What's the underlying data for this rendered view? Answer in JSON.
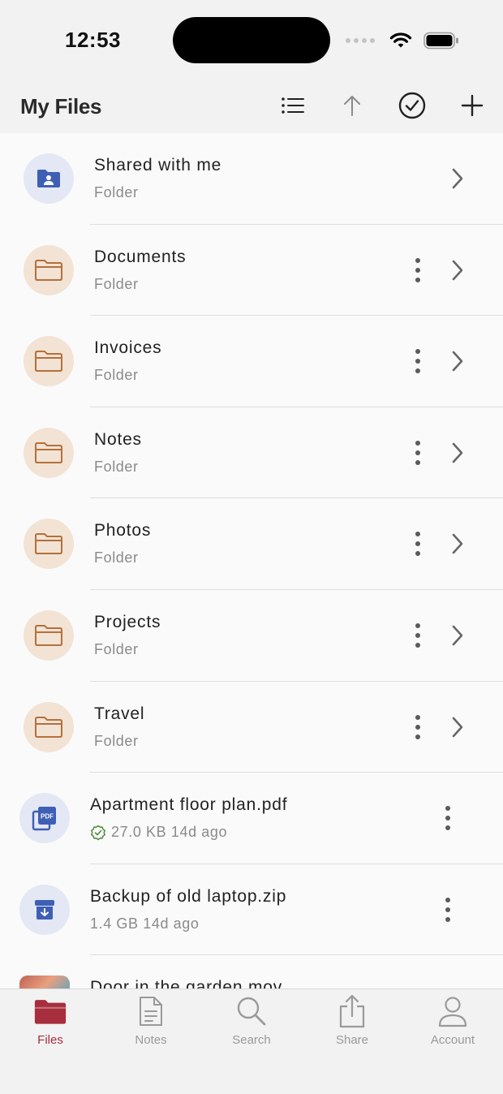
{
  "status_bar": {
    "time": "12:53"
  },
  "header": {
    "title": "My Files"
  },
  "colors": {
    "accent": "#a72e3c",
    "folder": "#b5703a",
    "blue": "#3f5fb5",
    "verified": "#4e8a3a"
  },
  "rows": [
    {
      "title": "Shared with me",
      "subtitle": "Folder",
      "icon": "shared-folder-icon"
    },
    {
      "title": "Documents",
      "subtitle": "Folder",
      "icon": "folder-icon"
    },
    {
      "title": "Invoices",
      "subtitle": "Folder",
      "icon": "folder-icon"
    },
    {
      "title": "Notes",
      "subtitle": "Folder",
      "icon": "folder-icon"
    },
    {
      "title": "Photos",
      "subtitle": "Folder",
      "icon": "folder-icon"
    },
    {
      "title": "Projects",
      "subtitle": "Folder",
      "icon": "folder-icon"
    },
    {
      "title": "Travel",
      "subtitle": "Folder",
      "icon": "folder-icon"
    },
    {
      "title": "Apartment floor plan.pdf",
      "subtitle": "27.0 KB 14d ago",
      "icon": "pdf-icon",
      "verified": true
    },
    {
      "title": "Backup of old laptop.zip",
      "subtitle": "1.4 GB 14d ago",
      "icon": "archive-icon"
    },
    {
      "title": "Door in the garden.mov",
      "subtitle": "",
      "icon": "video-thumbnail"
    }
  ],
  "tabs": [
    {
      "label": "Files",
      "icon": "folder-icon",
      "active": true
    },
    {
      "label": "Notes",
      "icon": "document-icon"
    },
    {
      "label": "Search",
      "icon": "search-icon"
    },
    {
      "label": "Share",
      "icon": "share-icon"
    },
    {
      "label": "Account",
      "icon": "person-icon"
    }
  ]
}
